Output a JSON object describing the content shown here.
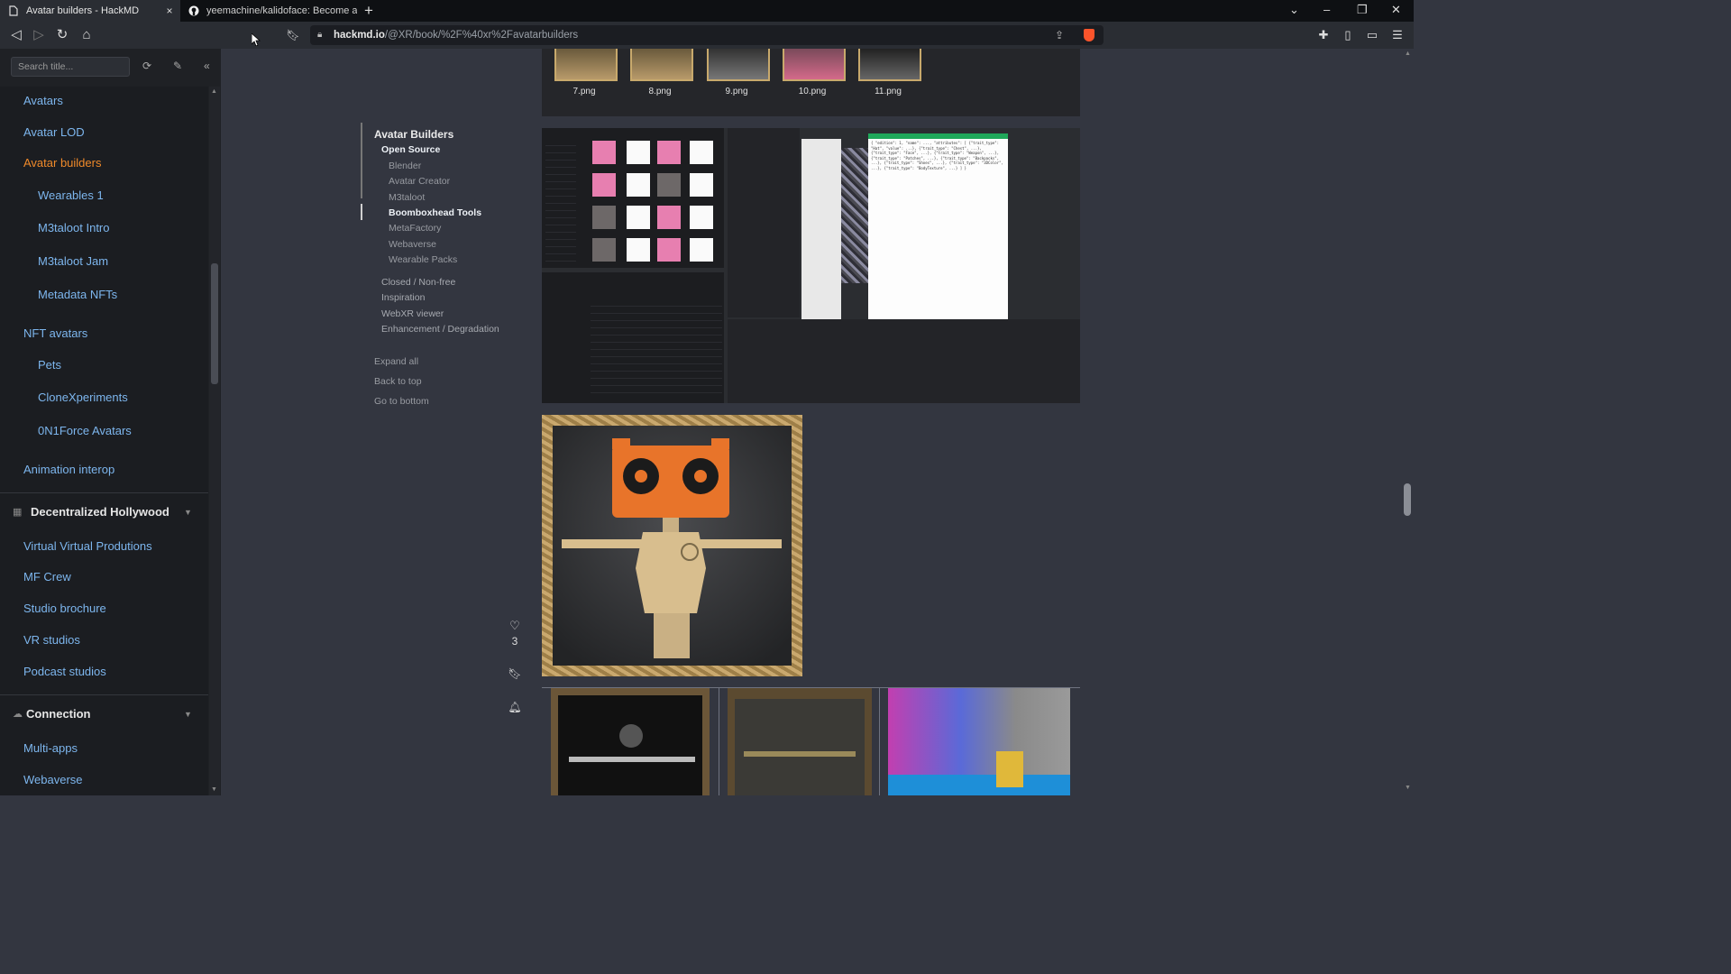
{
  "browser": {
    "tabs": [
      {
        "title": "Avatar builders - HackMD",
        "close": "×",
        "active": true
      },
      {
        "title": "yeemachine/kalidoface: Become a virt",
        "active": false
      }
    ],
    "new_tab": "+",
    "url_host": "hackmd.io",
    "url_path": "/@XR/book/%2F%40xr%2Favatarbuilders"
  },
  "sidebar": {
    "search_placeholder": "Search title...",
    "items": [
      {
        "label": "Avatars"
      },
      {
        "label": "Avatar LOD"
      },
      {
        "label": "Avatar builders",
        "active": true
      },
      {
        "label": "Wearables 1"
      },
      {
        "label": "M3taloot Intro"
      },
      {
        "label": "M3taloot Jam"
      },
      {
        "label": "Metadata NFTs"
      },
      {
        "label": "NFT avatars"
      },
      {
        "label": "Pets"
      },
      {
        "label": "CloneXperiments"
      },
      {
        "label": "0N1Force Avatars"
      },
      {
        "label": "Animation interop"
      }
    ],
    "section_hollywood": {
      "title": "Decentralized Hollywood",
      "items": [
        {
          "label": "Virtual Virtual Produtions"
        },
        {
          "label": "MF Crew"
        },
        {
          "label": "Studio brochure"
        },
        {
          "label": "VR studios"
        },
        {
          "label": "Podcast studios"
        }
      ]
    },
    "section_connection": {
      "title": "Connection",
      "items": [
        {
          "label": "Multi-apps"
        },
        {
          "label": "Webaverse"
        }
      ]
    }
  },
  "toc": {
    "title": "Avatar Builders",
    "open_source": "Open Source",
    "open_source_items": [
      "Blender",
      "Avatar Creator",
      "M3taloot",
      "Boomboxhead Tools",
      "MetaFactory",
      "Webaverse",
      "Wearable Packs"
    ],
    "current": "Boomboxhead Tools",
    "other_sections": [
      "Closed / Non-free",
      "Inspiration",
      "WebXR viewer",
      "Enhancement / Degradation"
    ],
    "expand_all": "Expand all",
    "back_to_top": "Back to top",
    "go_to_bottom": "Go to bottom"
  },
  "thumbnails": [
    "7.png",
    "8.png",
    "9.png",
    "10.png",
    "11.png"
  ],
  "likes": {
    "count": "3"
  }
}
